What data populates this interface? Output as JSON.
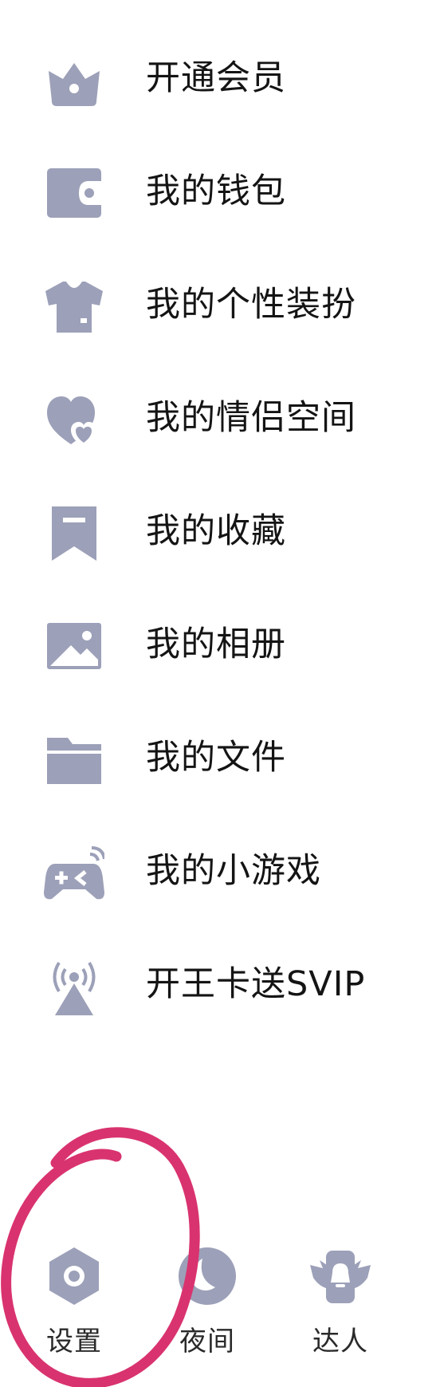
{
  "colors": {
    "icon": "#9ca0b8",
    "text": "#141414",
    "annotation": "#d9336f"
  },
  "menu": {
    "items": [
      {
        "icon": "crown-icon",
        "label": "开通会员"
      },
      {
        "icon": "wallet-icon",
        "label": "我的钱包"
      },
      {
        "icon": "tshirt-icon",
        "label": "我的个性装扮"
      },
      {
        "icon": "double-heart-icon",
        "label": "我的情侣空间"
      },
      {
        "icon": "bookmark-icon",
        "label": "我的收藏"
      },
      {
        "icon": "photo-icon",
        "label": "我的相册"
      },
      {
        "icon": "folder-icon",
        "label": "我的文件"
      },
      {
        "icon": "gamepad-icon",
        "label": "我的小游戏"
      },
      {
        "icon": "signal-tower-icon",
        "label": "开王卡送SVIP"
      }
    ]
  },
  "bottom_bar": {
    "items": [
      {
        "icon": "settings-hexagon-icon",
        "label": "设置"
      },
      {
        "icon": "moon-icon",
        "label": "夜间"
      },
      {
        "icon": "winged-badge-icon",
        "label": "达人"
      }
    ]
  }
}
